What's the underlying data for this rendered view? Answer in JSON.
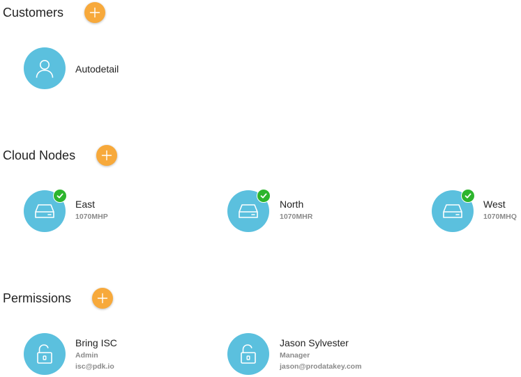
{
  "colors": {
    "accent": "#f7a93b",
    "avatar": "#5bc0de",
    "status_ok": "#2db52d",
    "text": "#222222",
    "subtext": "#8a8a8a"
  },
  "customers": {
    "title": "Customers",
    "items": [
      {
        "name": "Autodetail",
        "icon": "user-icon"
      }
    ]
  },
  "cloud_nodes": {
    "title": "Cloud Nodes",
    "items": [
      {
        "name": "East",
        "serial": "1070MHP",
        "icon": "server-icon",
        "status": "online"
      },
      {
        "name": "North",
        "serial": "1070MHR",
        "icon": "server-icon",
        "status": "online"
      },
      {
        "name": "West",
        "serial": "1070MHQ",
        "icon": "server-icon",
        "status": "online"
      }
    ]
  },
  "permissions": {
    "title": "Permissions",
    "items": [
      {
        "name": "Bring ISC",
        "role": "Admin",
        "email": "isc@pdk.io",
        "icon": "unlock-icon"
      },
      {
        "name": "Jason Sylvester",
        "role": "Manager",
        "email": "jason@prodatakey.com",
        "icon": "unlock-icon"
      }
    ]
  }
}
